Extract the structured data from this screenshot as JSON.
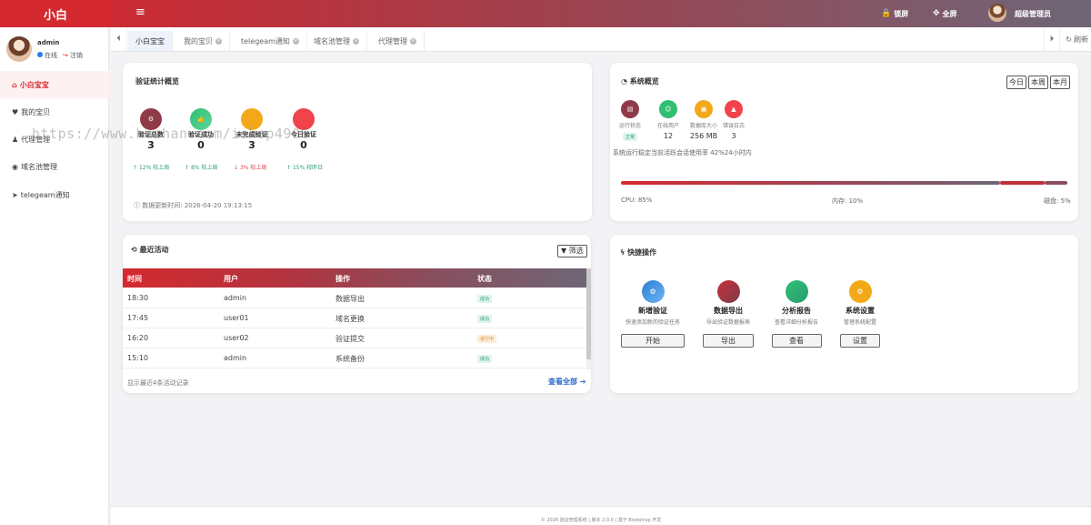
{
  "brand": "小白",
  "topbar": {
    "lock": "锁屏",
    "fullscreen": "全屏",
    "user": "超级管理员"
  },
  "sidebar": {
    "username": "admin",
    "online": "在线",
    "logout": "注销",
    "items": [
      {
        "label": "小白宝宝",
        "icon": "home-icon"
      },
      {
        "label": "我的宝贝",
        "icon": "heart-icon"
      },
      {
        "label": "代理管理",
        "icon": "user-icon"
      },
      {
        "label": "域名池管理",
        "icon": "globe-icon"
      },
      {
        "label": "telegeam通知",
        "icon": "telegram-icon"
      }
    ]
  },
  "tabs": [
    "小白宝宝",
    "我的宝贝",
    "telegeam通知",
    "域名池管理",
    "代理管理"
  ],
  "refresh": "刷新",
  "stats_card": {
    "title": "验证统计概览",
    "items": [
      {
        "label": "验证总数",
        "value": "3",
        "trend": "12% 较上周",
        "color": "#8f3b47"
      },
      {
        "label": "验证成功",
        "value": "0",
        "trend": "8% 较上周",
        "color": "#2fbf71"
      },
      {
        "label": "未完成验证",
        "value": "3",
        "trend": "3% 较上周",
        "color": "#f3a81a"
      },
      {
        "label": "今日验证",
        "value": "0",
        "trend": "15% 较昨日",
        "color": "#f0434b"
      }
    ],
    "updated": "数据更新时间: 2026-04-20 19:13:15"
  },
  "system_card": {
    "title": "系统概览",
    "periods": [
      "今日",
      "本周",
      "本月"
    ],
    "items": [
      {
        "label": "运行状态",
        "value": "正常",
        "color": "#8f3b47"
      },
      {
        "label": "在线用户",
        "value": "12",
        "color": "#2fbf71"
      },
      {
        "label": "数据库大小",
        "value": "256 MB",
        "color": "#f3a81a"
      },
      {
        "label": "错误日志",
        "value": "3",
        "color": "#f0434b"
      }
    ],
    "note": "系统运行稳定当前活跃会话使用率 42%24小时内",
    "cpu": "CPU: 85%",
    "memory": "内存: 10%",
    "disk": "磁盘: 5%",
    "cpu_level": 0.85,
    "memory_level": 0.1,
    "disk_level": 0.05
  },
  "activity_card": {
    "title": "最近活动",
    "filter": "筛选",
    "headers": [
      "时间",
      "用户",
      "操作",
      "状态"
    ],
    "rows": [
      {
        "time": "18:30",
        "user": "admin",
        "action": "数据导出",
        "status": "成功",
        "type": "success"
      },
      {
        "time": "17:45",
        "user": "user01",
        "action": "域名更换",
        "status": "成功",
        "type": "success"
      },
      {
        "time": "16:20",
        "user": "user02",
        "action": "验证提交",
        "status": "进行中",
        "type": "pending"
      },
      {
        "time": "15:10",
        "user": "admin",
        "action": "系统备份",
        "status": "成功",
        "type": "success"
      }
    ],
    "footer": "显示最近4条活动记录",
    "view_all": "查看全部"
  },
  "quick_card": {
    "title": "快捷操作",
    "items": [
      {
        "title": "新增验证",
        "desc": "快速添加新的验证任务",
        "button": "开始",
        "color": "#3e8fe0"
      },
      {
        "title": "数据导出",
        "desc": "导出验证数据报表",
        "button": "导出",
        "color": "#a0343d"
      },
      {
        "title": "分析报告",
        "desc": "查看详细分析报告",
        "button": "查看",
        "color": "#2fbf71"
      },
      {
        "title": "系统设置",
        "desc": "管理系统配置",
        "button": "设置",
        "color": "#f3a81a"
      }
    ]
  },
  "watermark": "https://www.huzhan.com/ishop4906",
  "footer": "© 2026 验证管理系统 | 版本 2.0.0 | 基于 Bootstrap 开发"
}
